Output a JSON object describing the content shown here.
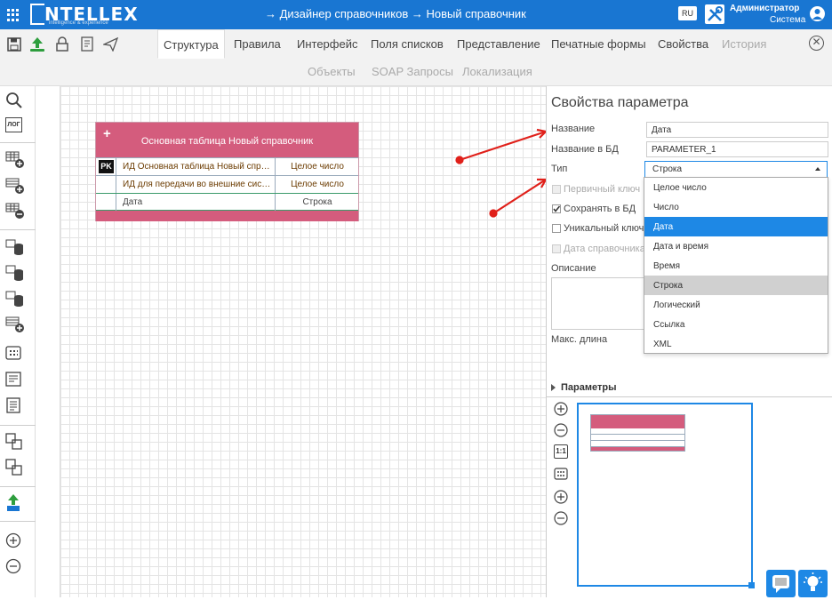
{
  "header": {
    "logo": "NTELLEX",
    "logo_tagline": "intelligence & experience",
    "breadcrumb": "→  Дизайнер справочников  →  Новый справочник",
    "lang": "RU",
    "user_name": "Администратор",
    "user_role": "Система",
    "bg_color": "#1976d2"
  },
  "toolbar": {
    "tabs_row1": [
      {
        "label": "Структура",
        "state": "active"
      },
      {
        "label": "Правила",
        "state": "normal"
      },
      {
        "label": "Интерфейс",
        "state": "normal"
      },
      {
        "label": "Поля списков",
        "state": "normal"
      },
      {
        "label": "Представление",
        "state": "normal"
      },
      {
        "label": "Печатные формы",
        "state": "normal"
      },
      {
        "label": "Свойства",
        "state": "normal"
      },
      {
        "label": "История",
        "state": "disabled"
      }
    ],
    "tabs_row2": [
      {
        "label": "Объекты",
        "state": "disabled"
      },
      {
        "label": "SOAP Запросы",
        "state": "disabled"
      },
      {
        "label": "Локализация",
        "state": "disabled"
      }
    ],
    "close_glyph": "✕",
    "action_icons": [
      "save-icon",
      "upload-icon",
      "lock-icon",
      "document-icon",
      "send-icon"
    ]
  },
  "sidebar": {
    "log_label": "ЛОГ",
    "icons": [
      "search-icon",
      "log-icon",
      "table-add-icon",
      "row-add-icon",
      "table-remove-icon",
      "database-icon",
      "database-edit-icon",
      "database-link-icon",
      "database-add-icon",
      "grid-icon",
      "form-icon",
      "report-icon",
      "copy-icon",
      "clone-icon",
      "import-icon",
      "zoom-in-icon",
      "zoom-out-icon"
    ]
  },
  "entity": {
    "add_glyph": "+",
    "title": "Основная таблица Новый справочник",
    "rows": [
      {
        "pk": "PK",
        "name": "ИД Основная таблица Новый справо...",
        "type": "Целое число"
      },
      {
        "pk": "",
        "name": "ИД для передачи во внешние системы",
        "type": "Целое число"
      },
      {
        "pk": "",
        "name": "Дата",
        "type": "Строка"
      }
    ],
    "header_color": "#d45c7d"
  },
  "props": {
    "title": "Свойства параметра",
    "name_label": "Название",
    "name_value": "Дата",
    "dbname_label": "Название в БД",
    "dbname_value": "PARAMETER_1",
    "type_label": "Тип",
    "type_value": "Строка",
    "checkboxes": [
      {
        "label": "Первичный ключ",
        "checked": false,
        "disabled": true
      },
      {
        "label": "Сохранять в БД",
        "checked": true,
        "disabled": false
      },
      {
        "label": "Уникальный ключ",
        "checked": false,
        "disabled": false
      },
      {
        "label": "Дата справочника",
        "checked": false,
        "disabled": true
      }
    ],
    "desc_label": "Описание",
    "maxlen_label": "Макс. длина",
    "params_header": "Параметры"
  },
  "type_options": [
    {
      "label": "Целое число",
      "state": "normal"
    },
    {
      "label": "Число",
      "state": "normal"
    },
    {
      "label": "Дата",
      "state": "highlight"
    },
    {
      "label": "Дата и время",
      "state": "normal"
    },
    {
      "label": "Время",
      "state": "normal"
    },
    {
      "label": "Строка",
      "state": "selected"
    },
    {
      "label": "Логический",
      "state": "normal"
    },
    {
      "label": "Ссылка",
      "state": "normal"
    },
    {
      "label": "XML",
      "state": "normal"
    }
  ],
  "zoom": {
    "one_to_one": "1:1",
    "icons": [
      "zoom-in-icon",
      "zoom-out-icon",
      "fit-icon",
      "grid-toggle-icon",
      "zoom-in-icon",
      "zoom-out-icon"
    ]
  },
  "annotation_color": "#e0201a",
  "accent_color": "#1e88e5"
}
